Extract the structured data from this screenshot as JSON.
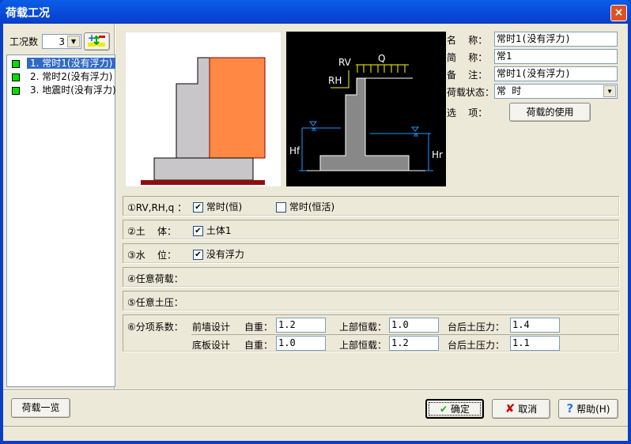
{
  "window": {
    "title": "荷载工况",
    "close": "×"
  },
  "left": {
    "count_label": "工况数",
    "count_value": "3",
    "list": [
      {
        "label": "1. 常时1(没有浮力)",
        "selected": true
      },
      {
        "label": "2. 常时2(没有浮力)"
      },
      {
        "label": "3. 地震时(没有浮力)"
      }
    ]
  },
  "diagram": {
    "rv": "RV",
    "rh": "RH",
    "q": "Q",
    "hf": "Hf",
    "hr": "Hr"
  },
  "form": {
    "name_label": "名    称：",
    "name_value": "常时1(没有浮力)",
    "short_label": "简    称：",
    "short_value": "常1",
    "note_label": "备    注：",
    "note_value": "常时1(没有浮力)",
    "state_label": "荷载状态：",
    "state_value": "常  时",
    "option_label": "选    项：",
    "usage_button": "荷载的使用"
  },
  "groups": {
    "g1": {
      "label": "①RV,RH,q ：",
      "opt1": "常时(恒)",
      "opt1_checked": true,
      "opt2": "常时(恒活)",
      "opt2_checked": false
    },
    "g2": {
      "label": "②土    体：",
      "opt1": "土体1",
      "opt1_checked": true
    },
    "g3": {
      "label": "③水    位：",
      "opt1": "没有浮力",
      "opt1_checked": true
    },
    "g4": {
      "label": "④任意荷载："
    },
    "g5": {
      "label": "⑤任意土压："
    },
    "g6": {
      "label": "⑥分项系数：",
      "rows": [
        {
          "name": "前墙设计",
          "self_label": "自重：",
          "self": "1.2",
          "upper_label": "上部恒载：",
          "upper": "1.0",
          "earth_label": "台后土压力：",
          "earth": "1.4"
        },
        {
          "name": "底板设计",
          "self_label": "自重：",
          "self": "1.0",
          "upper_label": "上部恒载：",
          "upper": "1.2",
          "earth_label": "台后土压力：",
          "earth": "1.1"
        }
      ]
    }
  },
  "buttons": {
    "list": "荷载一览",
    "ok": "确定",
    "cancel": "取消",
    "help": "帮助(H)"
  }
}
